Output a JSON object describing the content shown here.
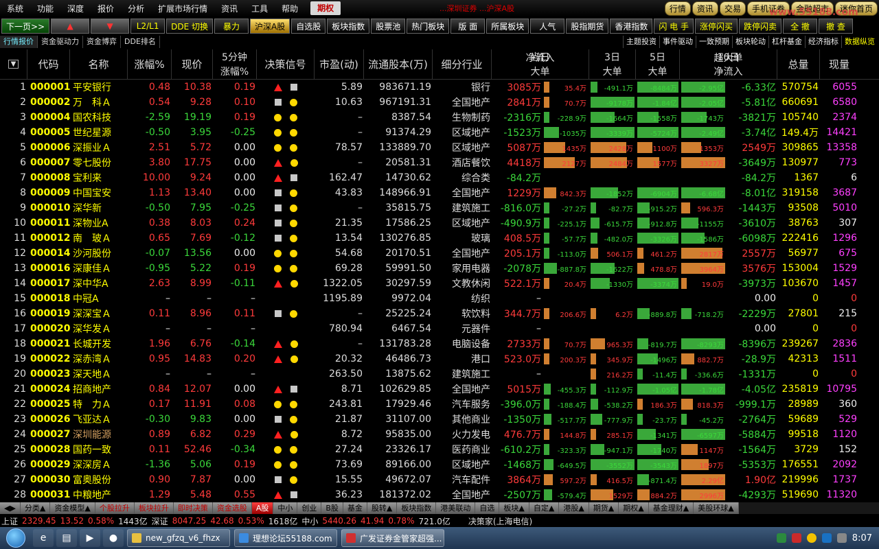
{
  "menubar": {
    "items": [
      "系统",
      "功能",
      "深度",
      "报价",
      "分析",
      "扩展市场行情",
      "资讯",
      "工具",
      "帮助"
    ],
    "active": "期权",
    "mid_text": "...深圳证券 ...沪深A股",
    "right_buttons": [
      "行情",
      "资讯",
      "交易",
      "手机证券",
      "金融超市",
      "迷你首页"
    ],
    "watermark": "www.55188.com"
  },
  "toolbar": {
    "items": [
      {
        "label": "下一页>>",
        "style": "g"
      },
      {
        "label": "▲",
        "style": "r"
      },
      {
        "label": "▼",
        "style": "r"
      },
      {
        "label": "L2/L1",
        "style": "y"
      },
      {
        "label": "DDE 切换",
        "style": "y"
      },
      {
        "label": "暴力",
        "style": "y"
      },
      {
        "label": "沪深A股",
        "style": "sel"
      },
      {
        "label": "自选股",
        "style": ""
      },
      {
        "label": "板块指数",
        "style": ""
      },
      {
        "label": "股票池",
        "style": ""
      },
      {
        "label": "热门板块",
        "style": ""
      },
      {
        "label": "版 面",
        "style": ""
      },
      {
        "label": "所属板块",
        "style": ""
      },
      {
        "label": "人气",
        "style": ""
      },
      {
        "label": "股指期货",
        "style": ""
      },
      {
        "label": "香港指数",
        "style": ""
      },
      {
        "label": "闪 电 手",
        "style": "y"
      },
      {
        "label": "涨停闪买",
        "style": "y"
      },
      {
        "label": "跌停闪卖",
        "style": "y"
      },
      {
        "label": "全 撤",
        "style": "y"
      },
      {
        "label": "撤 查",
        "style": "y"
      }
    ]
  },
  "tabs2": {
    "left": [
      "行情报价",
      "资金驱动力",
      "资金博弈",
      "DDE排名"
    ],
    "right": [
      "主题投资",
      "事件驱动",
      "一致预期",
      "板块轮动",
      "杠杆基金",
      "经济指标",
      "数据纵览"
    ]
  },
  "headers": {
    "code": "代码",
    "name": "名称",
    "chg": "涨幅%",
    "price": "现价",
    "five_top": "5分钟",
    "five_bot": "涨幅%",
    "signal": "决策信号",
    "pe": "市盈(动)",
    "float": "流通股本(万)",
    "industry": "细分行业",
    "today": "当日",
    "today_net": "净流入",
    "today_big": "大单",
    "d3": "3日",
    "d3_big": "大单",
    "d5": "5日",
    "d5_big": "大单",
    "d10": "10日",
    "d10_super": "超大单",
    "d10_net": "净流入",
    "vol": "总量",
    "cur": "现量"
  },
  "rows": [
    {
      "no": "1",
      "code": "000001",
      "name": "平安银行",
      "chg": "0.48",
      "price": "10.38",
      "five": "0.19",
      "sig": [
        "tri",
        "sq"
      ],
      "pe": "5.89",
      "float": "983671.19",
      "ind": "银行",
      "net": "3085万",
      "b1": "35.4万",
      "b2": "-491.1万",
      "b3": "-8484万",
      "b4": "-2.95亿",
      "net10": "-6.33亿",
      "vol": "570754",
      "cur": "6055",
      "curc": "mg"
    },
    {
      "no": "2",
      "code": "000002",
      "name": "万　科Ａ",
      "chg": "0.54",
      "price": "9.28",
      "five": "0.10",
      "sig": [
        "sq",
        "cir"
      ],
      "pe": "10.63",
      "float": "967191.31",
      "ind": "全国地产",
      "net": "2841万",
      "b1": "70.7万",
      "b2": "-9178万",
      "b3": "-1.84亿",
      "b4": "-2.05亿",
      "net10": "-5.81亿",
      "vol": "660691",
      "cur": "6580",
      "curc": "mg"
    },
    {
      "no": "3",
      "code": "000004",
      "name": "国农科技",
      "chg": "-2.59",
      "price": "19.19",
      "five": "0.19",
      "sig": [
        "cir",
        "cir"
      ],
      "pe": "–",
      "float": "8387.54",
      "ind": "生物制药",
      "net": "-2316万",
      "b1": "-228.9万",
      "b2": "-1664万",
      "b3": "-1558万",
      "b4": "-1743万",
      "net10": "-3821万",
      "vol": "105740",
      "cur": "2374",
      "curc": "mg"
    },
    {
      "no": "4",
      "code": "000005",
      "name": "世纪星源",
      "chg": "-0.50",
      "price": "3.95",
      "five": "-0.25",
      "sig": [
        "cir",
        "cir"
      ],
      "pe": "–",
      "float": "91374.29",
      "ind": "区域地产",
      "net": "-1523万",
      "b1": "-1035万",
      "b2": "-3339万",
      "b3": "-5724万",
      "b4": "-2.49亿",
      "net10": "-3.74亿",
      "vol": "149.4万",
      "cur": "14421",
      "curc": "mg"
    },
    {
      "no": "5",
      "code": "000006",
      "name": "深振业Ａ",
      "chg": "2.51",
      "price": "5.72",
      "five": "0.00",
      "sig": [
        "cir",
        "cir"
      ],
      "pe": "78.57",
      "float": "133889.70",
      "ind": "区域地产",
      "net": "5087万",
      "b1": "1435万",
      "b2": "2428万",
      "b3": "1100万",
      "b4": "1353万",
      "net10": "2549万",
      "vol": "309865",
      "cur": "13358",
      "curc": "mg"
    },
    {
      "no": "6",
      "code": "000007",
      "name": "零七股份",
      "chg": "3.80",
      "price": "17.75",
      "five": "0.00",
      "sig": [
        "tri",
        "cir"
      ],
      "pe": "–",
      "float": "20581.31",
      "ind": "酒店餐饮",
      "net": "4418万",
      "b1": "2127万",
      "b2": "2484万",
      "b3": "1577万",
      "b4": "3327万",
      "net10": "-3649万",
      "vol": "130977",
      "cur": "773",
      "curc": "mg"
    },
    {
      "no": "7",
      "code": "000008",
      "name": "宝利来",
      "chg": "10.00",
      "price": "9.24",
      "five": "0.00",
      "sig": [
        "tri",
        "sq"
      ],
      "pe": "162.47",
      "float": "14730.62",
      "ind": "综合类",
      "net": "-84.2万",
      "b1": "",
      "b2": "",
      "b3": "",
      "b4": "",
      "net10": "-84.2万",
      "vol": "1367",
      "cur": "6",
      "curc": "wh"
    },
    {
      "no": "8",
      "code": "000009",
      "name": "中国宝安",
      "chg": "1.13",
      "price": "13.40",
      "five": "0.00",
      "sig": [
        "sq",
        "cir"
      ],
      "pe": "43.83",
      "float": "148966.91",
      "ind": "全国地产",
      "net": "1229万",
      "b1": "842.3万",
      "b2": "-1852万",
      "b3": "-6904万",
      "b4": "-6.68亿",
      "net10": "-8.01亿",
      "vol": "319158",
      "cur": "3687",
      "curc": "mg"
    },
    {
      "no": "9",
      "code": "000010",
      "name": "深华新",
      "chg": "-0.50",
      "price": "7.95",
      "five": "-0.25",
      "sig": [
        "sq",
        "cir"
      ],
      "pe": "–",
      "float": "35815.75",
      "ind": "建筑施工",
      "net": "-816.0万",
      "b1": "-27.2万",
      "b2": "-82.7万",
      "b3": "-915.2万",
      "b4": "596.3万",
      "net10": "-1443万",
      "vol": "93508",
      "cur": "5010",
      "curc": "mg"
    },
    {
      "no": "10",
      "code": "000011",
      "name": "深物业A",
      "chg": "0.38",
      "price": "8.03",
      "five": "0.24",
      "sig": [
        "sq",
        "cir"
      ],
      "pe": "21.35",
      "float": "17586.25",
      "ind": "区域地产",
      "net": "-490.9万",
      "b1": "-225.1万",
      "b2": "-615.7万",
      "b3": "-912.8万",
      "b4": "-1155万",
      "net10": "-3610万",
      "vol": "38763",
      "cur": "307",
      "curc": "wh"
    },
    {
      "no": "11",
      "code": "000012",
      "name": "南　玻Ａ",
      "chg": "0.65",
      "price": "7.69",
      "five": "-0.12",
      "sig": [
        "sq",
        "cir"
      ],
      "pe": "13.54",
      "float": "130276.85",
      "ind": "玻璃",
      "net": "408.5万",
      "b1": "-57.7万",
      "b2": "-482.0万",
      "b3": "-3326万",
      "b4": "-1586万",
      "net10": "-6098万",
      "vol": "222416",
      "cur": "1296",
      "curc": "mg"
    },
    {
      "no": "12",
      "code": "000014",
      "name": "沙河股份",
      "chg": "-0.07",
      "price": "13.56",
      "five": "0.00",
      "sig": [
        "cir",
        "cir"
      ],
      "pe": "54.68",
      "float": "20170.51",
      "ind": "全国地产",
      "net": "205.1万",
      "b1": "-113.0万",
      "b2": "506.1万",
      "b3": "461.2万",
      "b4": "2817万",
      "net10": "2557万",
      "vol": "56977",
      "cur": "675",
      "curc": "mg"
    },
    {
      "no": "13",
      "code": "000016",
      "name": "深康佳Ａ",
      "chg": "-0.95",
      "price": "5.22",
      "five": "0.19",
      "sig": [
        "cir",
        "cir"
      ],
      "pe": "69.28",
      "float": "59991.50",
      "ind": "家用电器",
      "net": "-2078万",
      "b1": "-887.8万",
      "b2": "-1622万",
      "b3": "478.8万",
      "b4": "3964万",
      "net10": "3576万",
      "vol": "153004",
      "cur": "1529",
      "curc": "mg"
    },
    {
      "no": "14",
      "code": "000017",
      "name": "深中华A",
      "chg": "2.63",
      "price": "8.99",
      "five": "-0.11",
      "sig": [
        "tri",
        "cir"
      ],
      "pe": "1322.05",
      "float": "30297.59",
      "ind": "文教休闲",
      "net": "522.1万",
      "b1": "20.4万",
      "b2": "-1330万",
      "b3": "-3374万",
      "b4": "19.0万",
      "net10": "-3973万",
      "vol": "103670",
      "cur": "1457",
      "curc": "mg"
    },
    {
      "no": "15",
      "code": "000018",
      "name": "中冠A",
      "chg": "–",
      "price": "–",
      "five": "–",
      "sig": [],
      "pe": "1195.89",
      "float": "9972.04",
      "ind": "纺织",
      "net": "–",
      "b1": "",
      "b2": "",
      "b3": "",
      "b4": "",
      "net10": "0.00",
      "vol": "0",
      "cur": "0",
      "curc": "up"
    },
    {
      "no": "16",
      "code": "000019",
      "name": "深深宝Ａ",
      "chg": "0.11",
      "price": "8.96",
      "five": "0.11",
      "sig": [
        "sq",
        "cir"
      ],
      "pe": "–",
      "float": "25225.24",
      "ind": "软饮料",
      "net": "344.7万",
      "b1": "206.6万",
      "b2": "6.2万",
      "b3": "-889.8万",
      "b4": "-718.2万",
      "net10": "-2229万",
      "vol": "27801",
      "cur": "215",
      "curc": "wh"
    },
    {
      "no": "17",
      "code": "000020",
      "name": "深华发Ａ",
      "chg": "–",
      "price": "–",
      "five": "–",
      "sig": [],
      "pe": "780.94",
      "float": "6467.54",
      "ind": "元器件",
      "net": "–",
      "b1": "",
      "b2": "",
      "b3": "",
      "b4": "",
      "net10": "0.00",
      "vol": "0",
      "cur": "0",
      "curc": "up"
    },
    {
      "no": "18",
      "code": "000021",
      "name": "长城开发",
      "chg": "1.96",
      "price": "6.76",
      "five": "-0.14",
      "sig": [
        "tri",
        "cir"
      ],
      "pe": "–",
      "float": "131783.28",
      "ind": "电脑设备",
      "net": "2733万",
      "b1": "70.7万",
      "b2": "965.3万",
      "b3": "-819.7万",
      "b4": "-8293万",
      "net10": "-8396万",
      "vol": "239267",
      "cur": "2836",
      "curc": "mg"
    },
    {
      "no": "19",
      "code": "000022",
      "name": "深赤湾Ａ",
      "chg": "0.95",
      "price": "14.83",
      "five": "0.20",
      "sig": [
        "tri",
        "cir"
      ],
      "pe": "20.32",
      "float": "46486.73",
      "ind": "港口",
      "net": "523.0万",
      "b1": "200.3万",
      "b2": "345.9万",
      "b3": "-1496万",
      "b4": "882.7万",
      "net10": "-28.9万",
      "vol": "42313",
      "cur": "1511",
      "curc": "mg"
    },
    {
      "no": "20",
      "code": "000023",
      "name": "深天地Ａ",
      "chg": "–",
      "price": "–",
      "five": "–",
      "sig": [],
      "pe": "263.50",
      "float": "13875.62",
      "ind": "建筑施工",
      "net": "–",
      "b1": "",
      "b2": "216.2万",
      "b3": "-11.4万",
      "b4": "-336.6万",
      "net10": "-1331万",
      "vol": "0",
      "cur": "0",
      "curc": "up"
    },
    {
      "no": "21",
      "code": "000024",
      "name": "招商地产",
      "chg": "0.84",
      "price": "12.07",
      "five": "0.00",
      "sig": [
        "tri",
        "sq"
      ],
      "pe": "8.71",
      "float": "102629.85",
      "ind": "全国地产",
      "net": "5015万",
      "b1": "-455.3万",
      "b2": "-112.9万",
      "b3": "-1.05亿",
      "b4": "-1.78亿",
      "net10": "-4.05亿",
      "vol": "235819",
      "cur": "10795",
      "curc": "mg"
    },
    {
      "no": "22",
      "code": "000025",
      "name": "特　力Ａ",
      "chg": "0.17",
      "price": "11.91",
      "five": "0.08",
      "sig": [
        "cir",
        "cir"
      ],
      "pe": "243.81",
      "float": "17929.46",
      "ind": "汽车服务",
      "net": "-396.0万",
      "b1": "-188.4万",
      "b2": "-538.2万",
      "b3": "186.3万",
      "b4": "818.3万",
      "net10": "-999.1万",
      "vol": "28989",
      "cur": "360",
      "curc": "wh"
    },
    {
      "no": "23",
      "code": "000026",
      "name": "飞亚达Ａ",
      "chg": "-0.30",
      "price": "9.83",
      "five": "0.00",
      "sig": [
        "sq",
        "cir"
      ],
      "pe": "21.87",
      "float": "31107.00",
      "ind": "其他商业",
      "net": "-1350万",
      "b1": "-517.7万",
      "b2": "-777.9万",
      "b3": "-23.7万",
      "b4": "-45.2万",
      "net10": "-2764万",
      "vol": "59689",
      "cur": "529",
      "curc": "mg"
    },
    {
      "no": "24",
      "code": "000027",
      "name": "深圳能源",
      "chg": "0.89",
      "price": "6.82",
      "five": "0.29",
      "sig": [
        "tri",
        "cir"
      ],
      "pe": "8.72",
      "float": "95835.00",
      "ind": "火力发电",
      "net": "476.7万",
      "b1": "144.8万",
      "b2": "285.1万",
      "b3": "-1341万",
      "b4": "-6597万",
      "net10": "-5884万",
      "vol": "99518",
      "cur": "1120",
      "curc": "mg"
    },
    {
      "no": "25",
      "code": "000028",
      "name": "国药一致",
      "chg": "0.11",
      "price": "52.46",
      "five": "-0.34",
      "sig": [
        "cir",
        "cir"
      ],
      "pe": "27.24",
      "float": "23326.17",
      "ind": "医药商业",
      "net": "-610.2万",
      "b1": "-323.3万",
      "b2": "-947.1万",
      "b3": "-1740万",
      "b4": "1147万",
      "net10": "-1564万",
      "vol": "3729",
      "cur": "152",
      "curc": "wh"
    },
    {
      "no": "26",
      "code": "000029",
      "name": "深深房Ａ",
      "chg": "-1.36",
      "price": "5.06",
      "five": "0.19",
      "sig": [
        "cir",
        "cir"
      ],
      "pe": "73.69",
      "float": "89166.00",
      "ind": "区域地产",
      "net": "-1468万",
      "b1": "-649.5万",
      "b2": "-3552万",
      "b3": "-3543万",
      "b4": "1897万",
      "net10": "-5353万",
      "vol": "176551",
      "cur": "2092",
      "curc": "mg"
    },
    {
      "no": "27",
      "code": "000030",
      "name": "富奥股份",
      "chg": "0.90",
      "price": "7.87",
      "five": "0.00",
      "sig": [
        "sq",
        "cir"
      ],
      "pe": "15.55",
      "float": "49672.07",
      "ind": "汽车配件",
      "net": "3864万",
      "b1": "597.2万",
      "b2": "416.5万",
      "b3": "-871.4万",
      "b4": "2.29亿",
      "net10": "1.90亿",
      "vol": "219996",
      "cur": "1737",
      "curc": "mg"
    },
    {
      "no": "28",
      "code": "000031",
      "name": "中粮地产",
      "chg": "1.29",
      "price": "5.48",
      "five": "0.55",
      "sig": [
        "tri",
        "sq"
      ],
      "pe": "36.23",
      "float": "181372.02",
      "ind": "全国地产",
      "net": "-2507万",
      "b1": "-579.4万",
      "b2": "1529万",
      "b3": "884.2万",
      "b4": "2996万",
      "net10": "-4293万",
      "vol": "519690",
      "cur": "11320",
      "curc": "mg"
    }
  ],
  "bottom_tabs": [
    "分类▲",
    "资金模型▲",
    "个股拉升",
    "板块拉升",
    "即时决策",
    "资金选股",
    "A股",
    "中小",
    "创业",
    "B股",
    "基金",
    "股转▲",
    "板块指数",
    "港美联动",
    "自选",
    "板块▲",
    "自定▲",
    "港股▲",
    "期货▲",
    "期权▲",
    "基金理财▲",
    "美股环球▲"
  ],
  "bottom_active": "A股",
  "status": {
    "sh_label": "上证",
    "sh_val": "2329.45",
    "sh_chg": "13.52",
    "sh_pct": "0.58%",
    "sh_amt": "1443亿",
    "sz_label": "深证",
    "sz_val": "8047.25",
    "sz_chg": "42.68",
    "sz_pct": "0.53%",
    "sz_amt": "1618亿",
    "zx_label": "中小",
    "zx_val": "5440.26",
    "zx_chg": "41.94",
    "zx_pct": "0.78%",
    "zx_amt": "721.0亿",
    "right": "决策家(上海电信)"
  },
  "taskbar": {
    "tasks": [
      "new_gfzq_v6_fhzx",
      "理想论坛55188.com",
      "广发证券金管家超强..."
    ],
    "time": "8:07"
  },
  "colors": {
    "up": "#ff3b3b",
    "down": "#3bd83b",
    "code": "#ffff00",
    "bar_pos": "#d07f30",
    "bar_neg": "#3aa83a"
  }
}
